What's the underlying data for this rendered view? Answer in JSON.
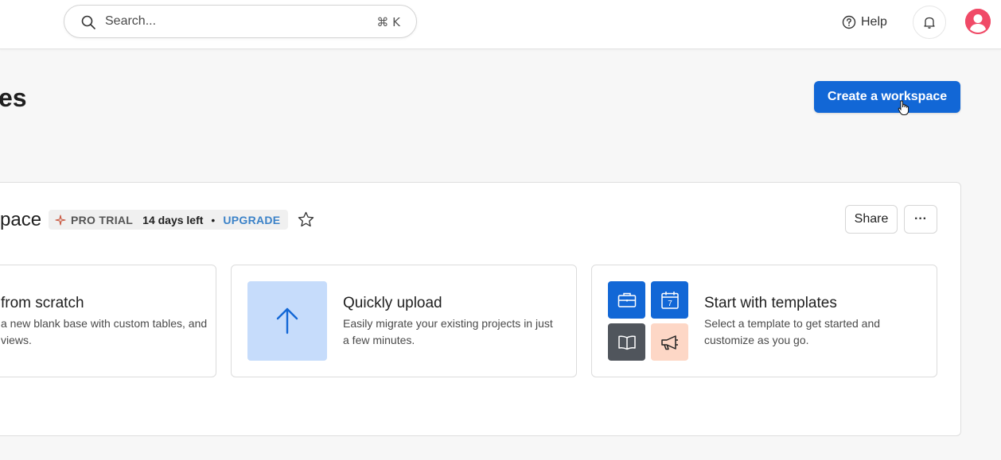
{
  "header": {
    "search_placeholder": "Search...",
    "search_shortcut": "⌘ K",
    "help_label": "Help"
  },
  "page": {
    "title": "es",
    "create_button": "Create a workspace"
  },
  "workspace": {
    "name": "pace",
    "badge": {
      "plan": "PRO TRIAL",
      "days_left": "14 days left",
      "separator": "•",
      "upgrade": "UPGRADE"
    },
    "share_label": "Share",
    "more_label": "···"
  },
  "options": [
    {
      "title": "from scratch",
      "description": "a new blank base with custom tables, and views."
    },
    {
      "title": "Quickly upload",
      "description": "Easily migrate your existing projects in just a few minutes."
    },
    {
      "title": "Start with templates",
      "description": "Select a template to get started and customize as you go."
    }
  ],
  "icons": {
    "search": "search-icon",
    "help": "help-circle-icon",
    "bell": "bell-icon",
    "avatar": "user-avatar-icon",
    "sparkle": "sparkle-icon",
    "star": "star-icon",
    "upload": "arrow-up-icon",
    "briefcase": "briefcase-icon",
    "calendar": "calendar-icon",
    "book": "book-icon",
    "megaphone": "megaphone-icon"
  },
  "colors": {
    "primary": "#1267d6",
    "avatar": "#f04a67",
    "upgrade": "#3b82c8",
    "upload_tile": "#c6dcfb",
    "book_tile": "#50555c",
    "megaphone_tile": "#fdd7c6"
  },
  "calendar_day": "7"
}
